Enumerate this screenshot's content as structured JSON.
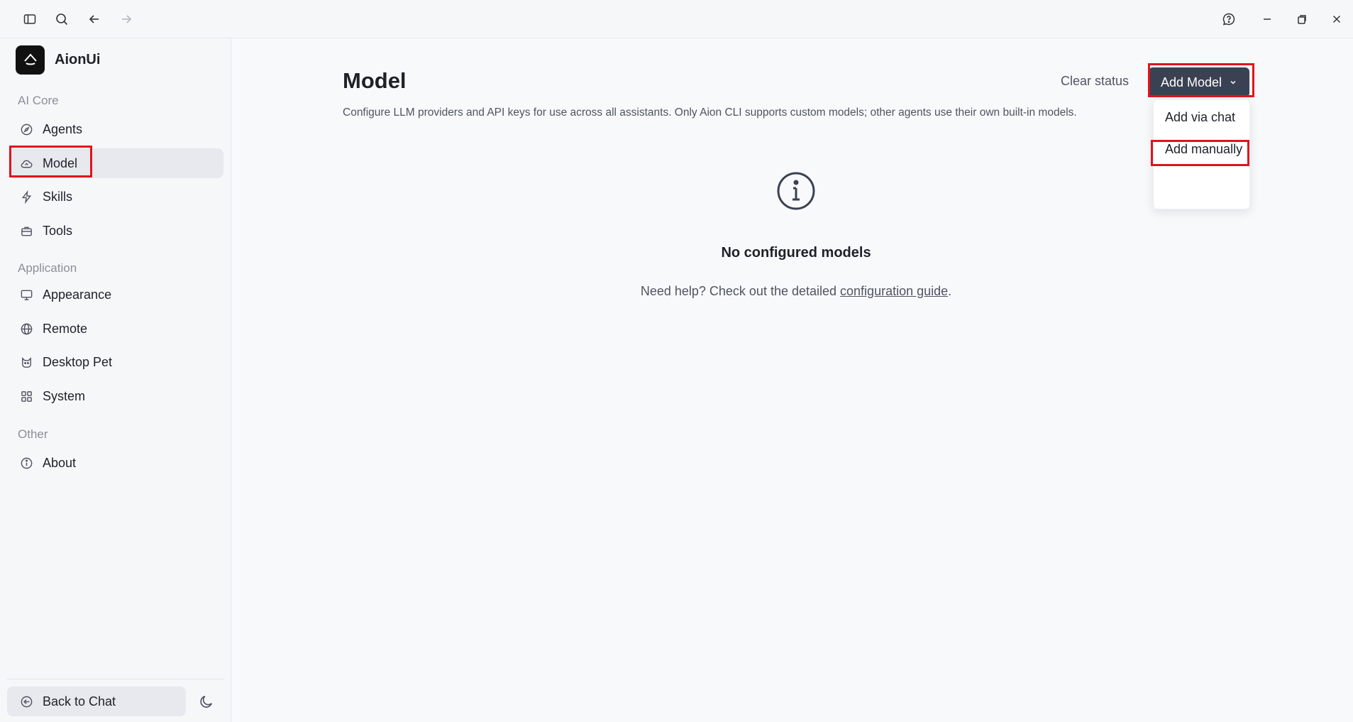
{
  "titlebar": {
    "left_icons": [
      "sidebar-toggle-icon",
      "search-icon",
      "arrow-left-icon",
      "arrow-right-icon"
    ],
    "right_icons": [
      "help-chat-icon",
      "minimize-icon",
      "restore-icon",
      "close-icon"
    ]
  },
  "sidebar": {
    "brand": "AionUi",
    "sections": {
      "ai_core": "AI Core",
      "application": "Application",
      "other": "Other"
    },
    "items": [
      {
        "label": "Agents",
        "icon": "compass-icon"
      },
      {
        "label": "Model",
        "icon": "cloud-icon",
        "active": true
      },
      {
        "label": "Skills",
        "icon": "lightning-icon"
      },
      {
        "label": "Tools",
        "icon": "toolbox-icon"
      },
      {
        "label": "Appearance",
        "icon": "monitor-icon"
      },
      {
        "label": "Remote",
        "icon": "globe-icon"
      },
      {
        "label": "Desktop Pet",
        "icon": "pet-icon"
      },
      {
        "label": "System",
        "icon": "grid-icon"
      },
      {
        "label": "About",
        "icon": "info-icon"
      }
    ],
    "back_label": "Back to Chat"
  },
  "main": {
    "title": "Model",
    "description": "Configure LLM providers and API keys for use across all assistants. Only Aion CLI supports custom models; other agents use their own built-in models.",
    "clear_status": "Clear status",
    "add_model": "Add Model",
    "dropdown": {
      "add_via_chat": "Add via chat",
      "add_manually": "Add manually"
    },
    "empty": {
      "title": "No configured models",
      "help_prefix": "Need help? Check out the detailed ",
      "help_link": "configuration guide",
      "help_suffix": "."
    }
  },
  "colors": {
    "accent_button": "#3a4152",
    "highlight": "#e0141e",
    "active_item_bg": "#e8e9ee"
  }
}
